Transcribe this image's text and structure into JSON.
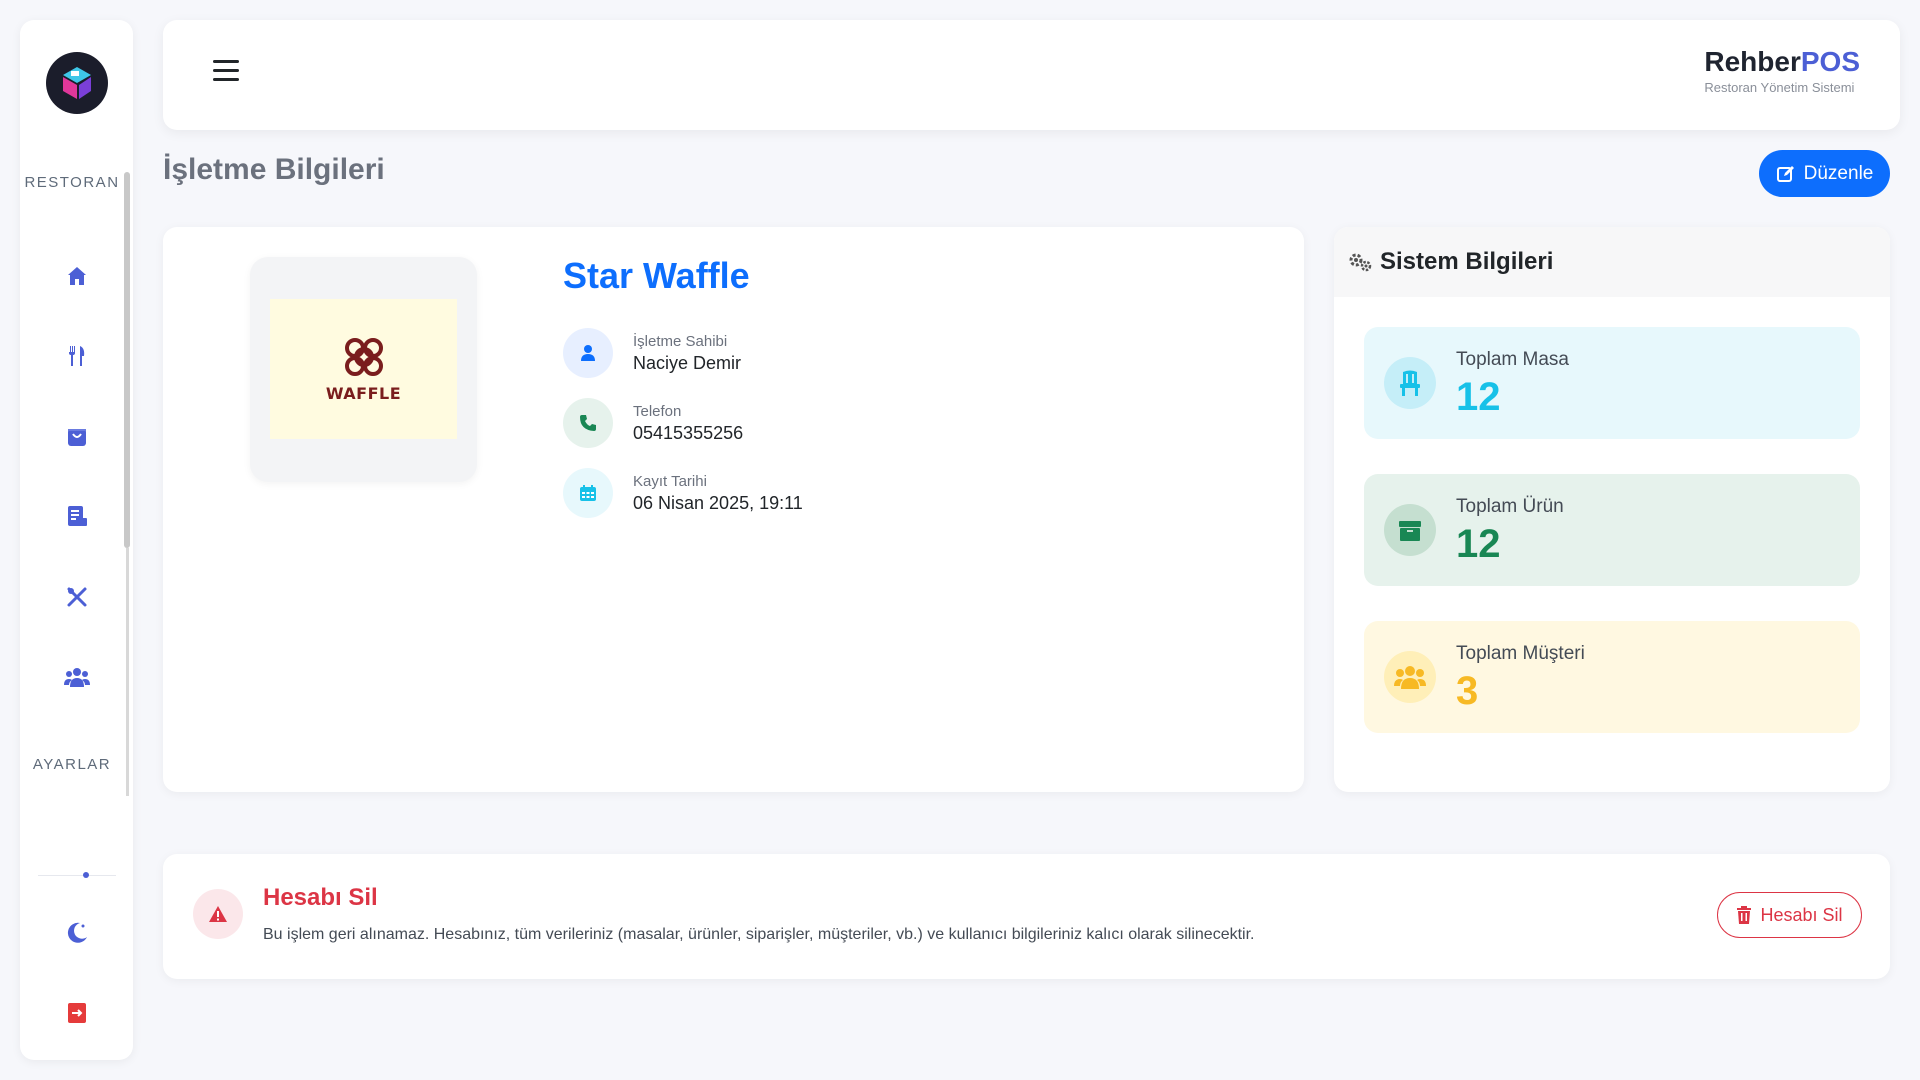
{
  "sidebar": {
    "section_restaurant": "RESTORAN",
    "section_settings": "AYARLAR",
    "icons": [
      "home-icon",
      "utensils-icon",
      "shopping-bag-icon",
      "receipt-icon",
      "kitchen-tools-icon",
      "users-icon",
      "moon-icon",
      "logout-icon"
    ]
  },
  "header": {
    "brand_prefix": "Rehber",
    "brand_suffix": "POS",
    "brand_subtitle": "Restoran Yönetim Sistemi"
  },
  "page": {
    "title": "İşletme Bilgileri",
    "edit_label": "Düzenle"
  },
  "business": {
    "logo_text": "WAFFLE",
    "name": "Star Waffle",
    "owner_label": "İşletme Sahibi",
    "owner_value": "Naciye Demir",
    "phone_label": "Telefon",
    "phone_value": "05415355256",
    "date_label": "Kayıt Tarihi",
    "date_value": "06 Nisan 2025, 19:11"
  },
  "system": {
    "title": "Sistem Bilgileri",
    "stats": [
      {
        "label": "Toplam Masa",
        "value": "12",
        "color": "#17c1e8",
        "bg": "#e7f8fc"
      },
      {
        "label": "Toplam Ürün",
        "value": "12",
        "color": "#198754",
        "bg": "#e6f2ec"
      },
      {
        "label": "Toplam Müşteri",
        "value": "3",
        "color": "#f7b924",
        "bg": "#fff8e1"
      }
    ]
  },
  "danger": {
    "title": "Hesabı Sil",
    "description": "Bu işlem geri alınamaz. Hesabınız, tüm verileriniz (masalar, ürünler, siparişler, müşteriler, vb.) ve kullanıcı bilgileriniz kalıcı olarak silinecektir.",
    "button_label": "Hesabı Sil"
  },
  "colors": {
    "primary": "#0d6efd",
    "brand": "#4c5fd5",
    "danger": "#dc3545"
  }
}
